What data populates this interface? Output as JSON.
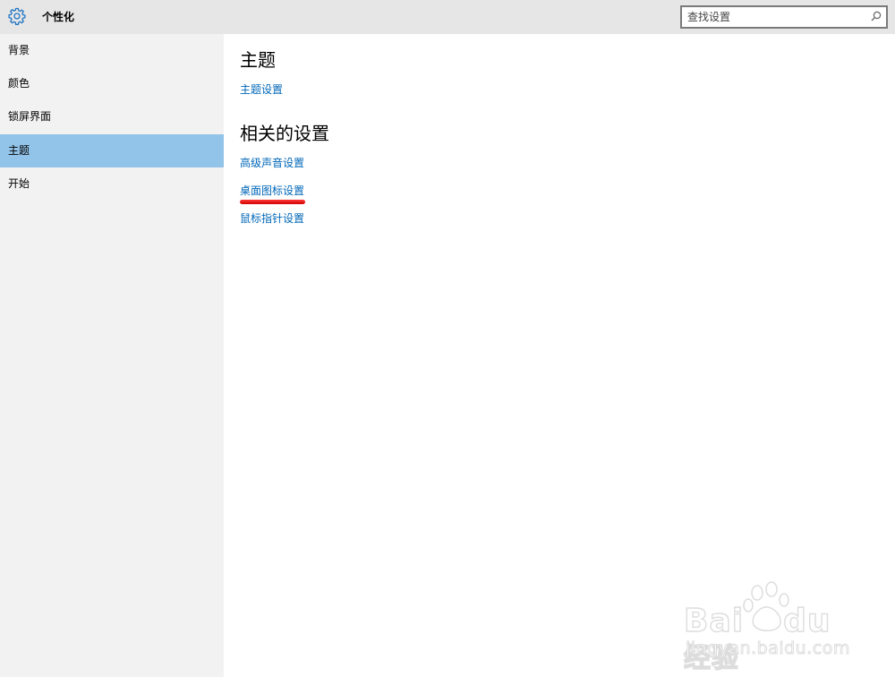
{
  "header": {
    "title": "个性化",
    "search_placeholder": "查找设置"
  },
  "sidebar": {
    "items": [
      {
        "label": "背景"
      },
      {
        "label": "颜色"
      },
      {
        "label": "锁屏界面"
      },
      {
        "label": "主题"
      },
      {
        "label": "开始"
      }
    ],
    "active_label": "主题"
  },
  "main": {
    "section_title": "主题",
    "theme_settings_link": "主题设置",
    "related_title": "相关的设置",
    "related_links": [
      {
        "label": "高级声音设置"
      },
      {
        "label": "桌面图标设置"
      },
      {
        "label": "鼠标指针设置"
      }
    ]
  },
  "watermark": {
    "logo_text": "Bai",
    "logo_text_2": "du",
    "logo_cn": "经验",
    "url": "jingyan.baidu.com"
  },
  "colors": {
    "accent": "#0067b8",
    "selected_nav": "#92c3e8",
    "highlight_mark": "#e00000"
  }
}
